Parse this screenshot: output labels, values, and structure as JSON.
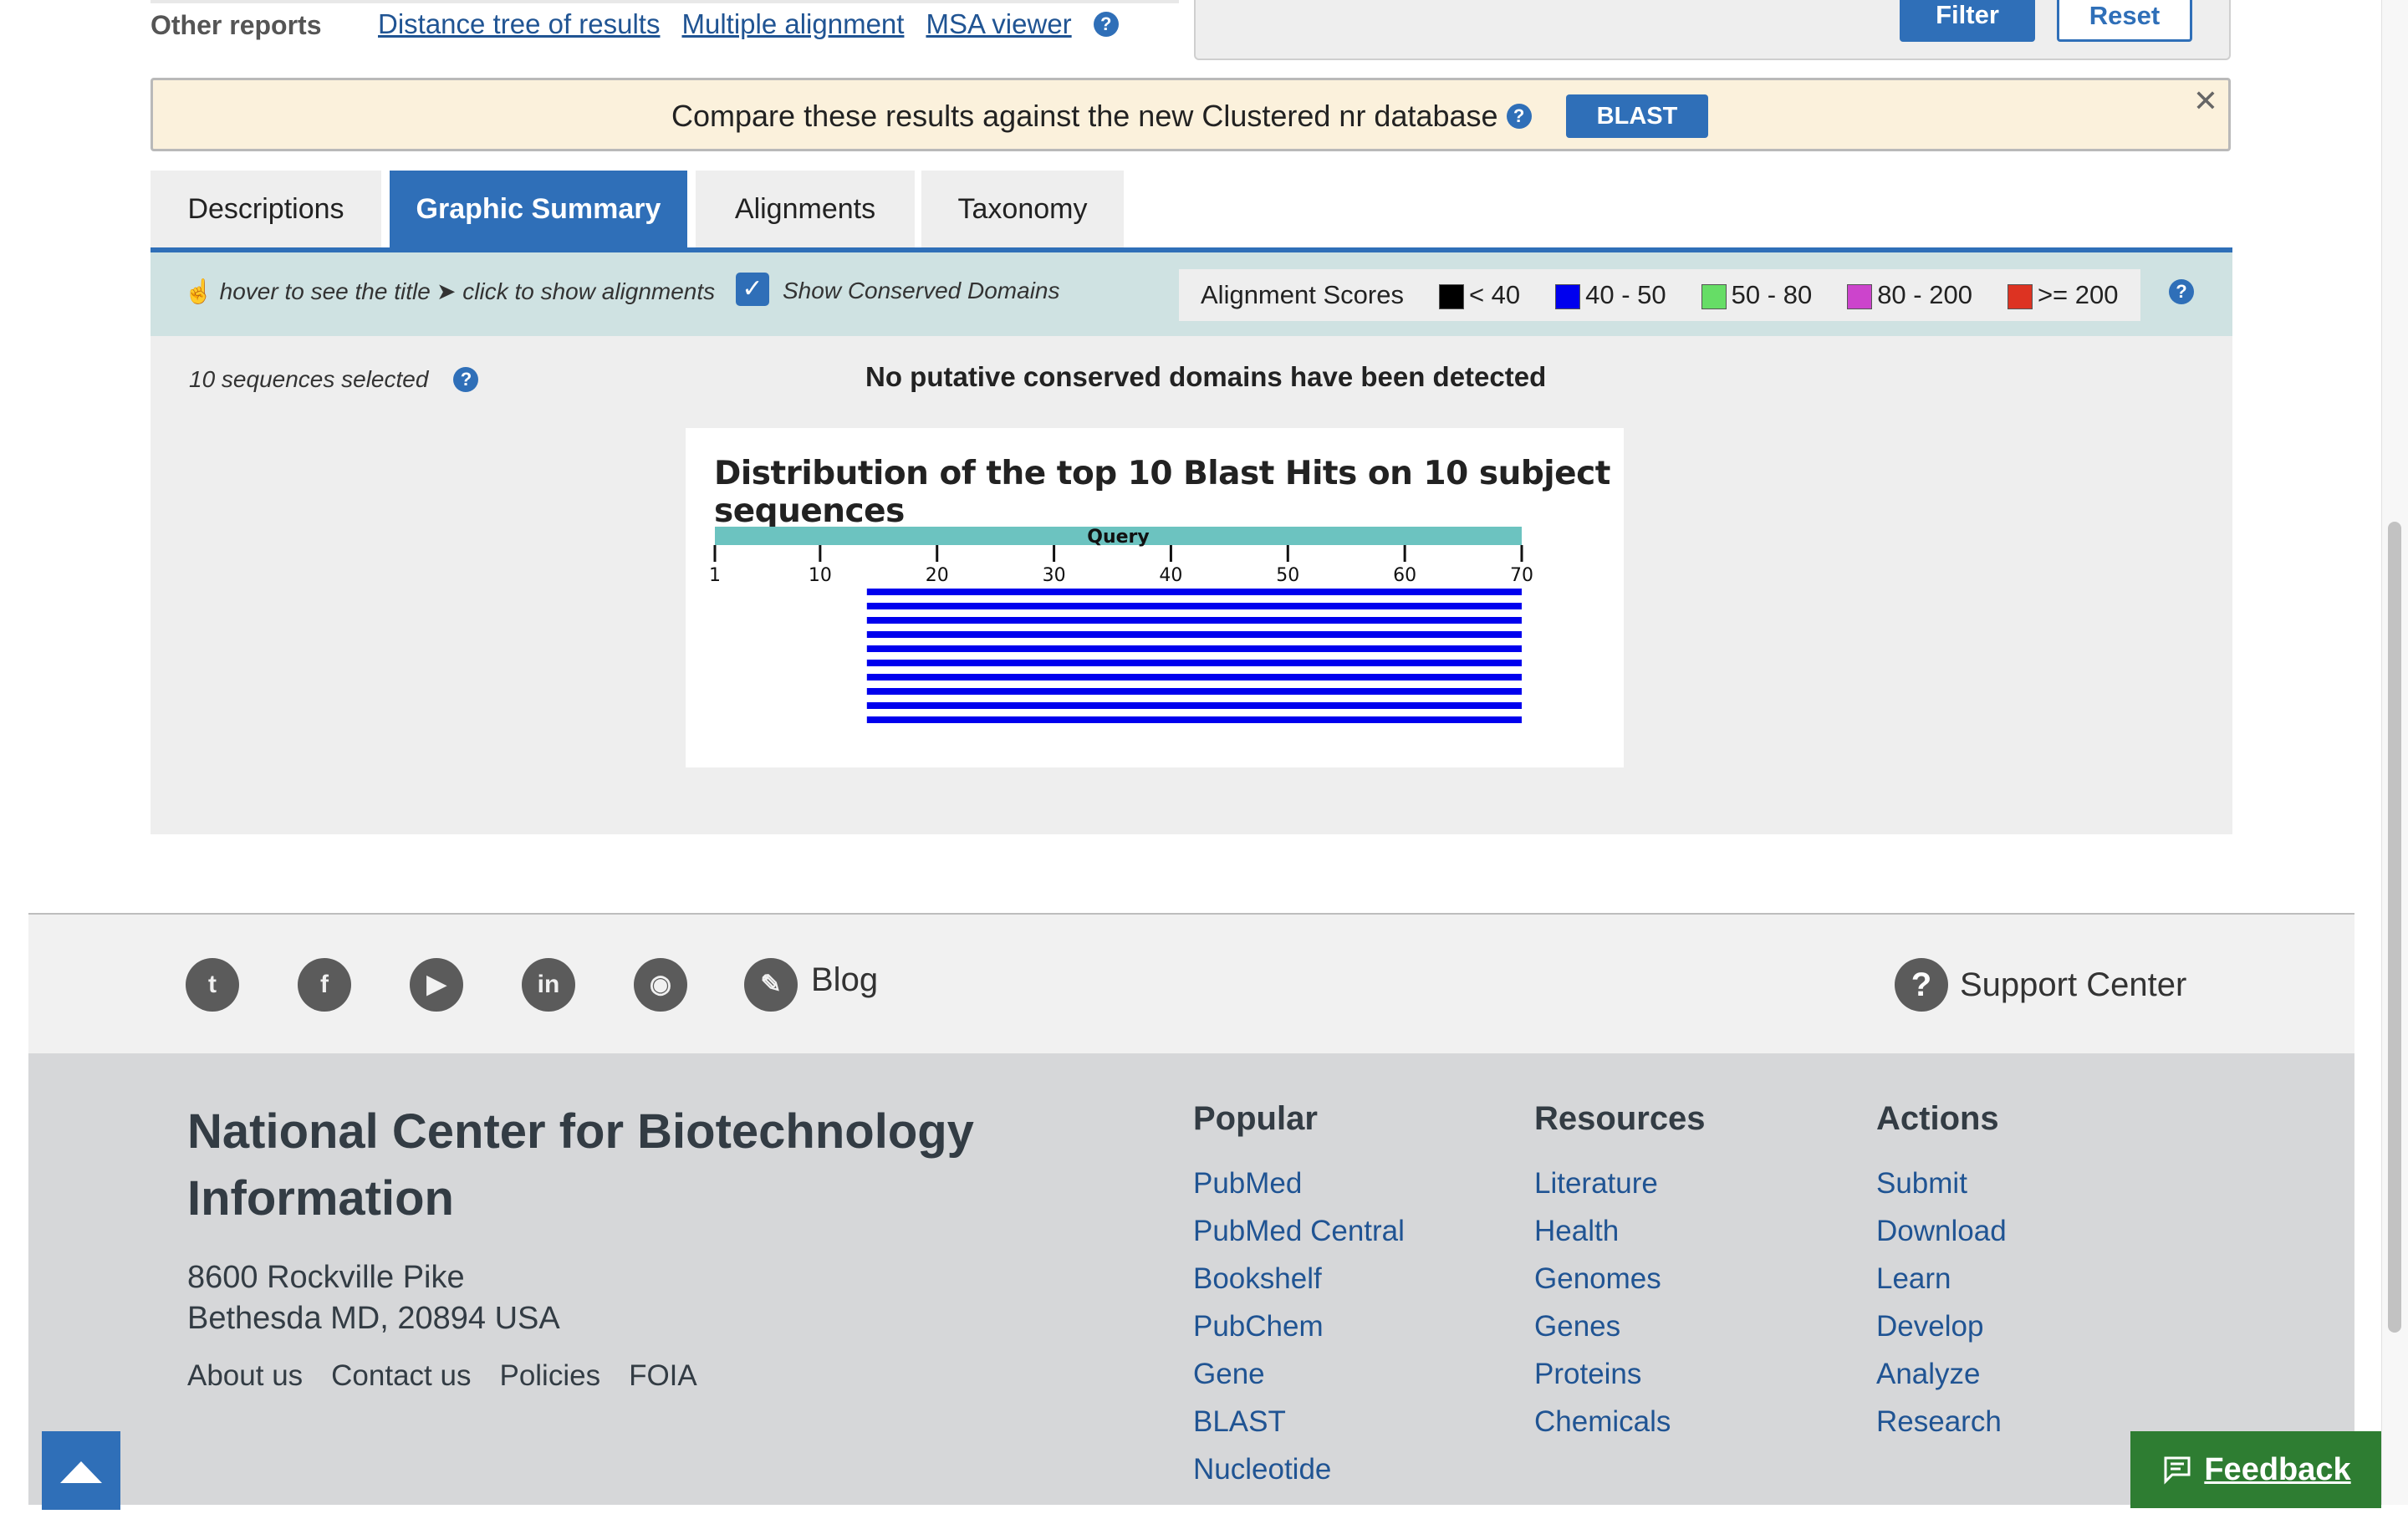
{
  "other_reports": {
    "label": "Other reports",
    "links": [
      "Distance tree of results",
      "Multiple alignment",
      "MSA viewer"
    ]
  },
  "filter": {
    "filter_label": "Filter",
    "reset_label": "Reset"
  },
  "banner": {
    "message": "Compare these results against the new Clustered nr database",
    "button": "BLAST",
    "close": "✕"
  },
  "tabs": [
    "Descriptions",
    "Graphic Summary",
    "Alignments",
    "Taxonomy"
  ],
  "active_tab": "Graphic Summary",
  "toolbar": {
    "hover_hint": "hover to see the title",
    "click_hint": "click to show alignments",
    "show_domains_label": "Show Conserved Domains",
    "show_domains_checked": true,
    "scores_label": "Alignment Scores",
    "scores": [
      {
        "label": "< 40",
        "color": "#000000"
      },
      {
        "label": "40 - 50",
        "color": "#0000ee"
      },
      {
        "label": "50 - 80",
        "color": "#66dd66"
      },
      {
        "label": "80 - 200",
        "color": "#cc44cc"
      },
      {
        "label": ">= 200",
        "color": "#dd3322"
      }
    ]
  },
  "content": {
    "sequences_selected": "10 sequences selected",
    "no_domains": "No putative conserved domains have been detected"
  },
  "chart_data": {
    "type": "bar",
    "title": "Distribution of the top 10 Blast Hits on 10 subject sequences",
    "query_label": "Query",
    "query_range": [
      1,
      70
    ],
    "ticks": [
      1,
      10,
      20,
      30,
      40,
      50,
      60,
      70
    ],
    "hits": [
      {
        "start": 14,
        "end": 70,
        "color": "#0000ee"
      },
      {
        "start": 14,
        "end": 70,
        "color": "#0000ee"
      },
      {
        "start": 14,
        "end": 70,
        "color": "#0000ee"
      },
      {
        "start": 14,
        "end": 70,
        "color": "#0000ee"
      },
      {
        "start": 14,
        "end": 70,
        "color": "#0000ee"
      },
      {
        "start": 14,
        "end": 70,
        "color": "#0000ee"
      },
      {
        "start": 14,
        "end": 70,
        "color": "#0000ee"
      },
      {
        "start": 14,
        "end": 70,
        "color": "#0000ee"
      },
      {
        "start": 14,
        "end": 70,
        "color": "#0000ee"
      },
      {
        "start": 14,
        "end": 70,
        "color": "#0000ee"
      }
    ],
    "query_bar_color": "#6cc3c0"
  },
  "footer": {
    "social_icons": [
      "twitter-icon",
      "facebook-icon",
      "youtube-icon",
      "linkedin-icon",
      "github-icon",
      "blog-icon"
    ],
    "blog": "Blog",
    "support": "Support Center",
    "org_name": "National Center for Biotechnology Information",
    "address_line1": "8600 Rockville Pike",
    "address_line2": "Bethesda MD, 20894 USA",
    "links": [
      "About us",
      "Contact us",
      "Policies",
      "FOIA"
    ],
    "columns": [
      {
        "heading": "Popular",
        "items": [
          "PubMed",
          "PubMed Central",
          "Bookshelf",
          "PubChem",
          "Gene",
          "BLAST",
          "Nucleotide"
        ]
      },
      {
        "heading": "Resources",
        "items": [
          "Literature",
          "Health",
          "Genomes",
          "Genes",
          "Proteins",
          "Chemicals"
        ]
      },
      {
        "heading": "Actions",
        "items": [
          "Submit",
          "Download",
          "Learn",
          "Develop",
          "Analyze",
          "Research"
        ]
      }
    ],
    "feedback": "Feedback"
  }
}
